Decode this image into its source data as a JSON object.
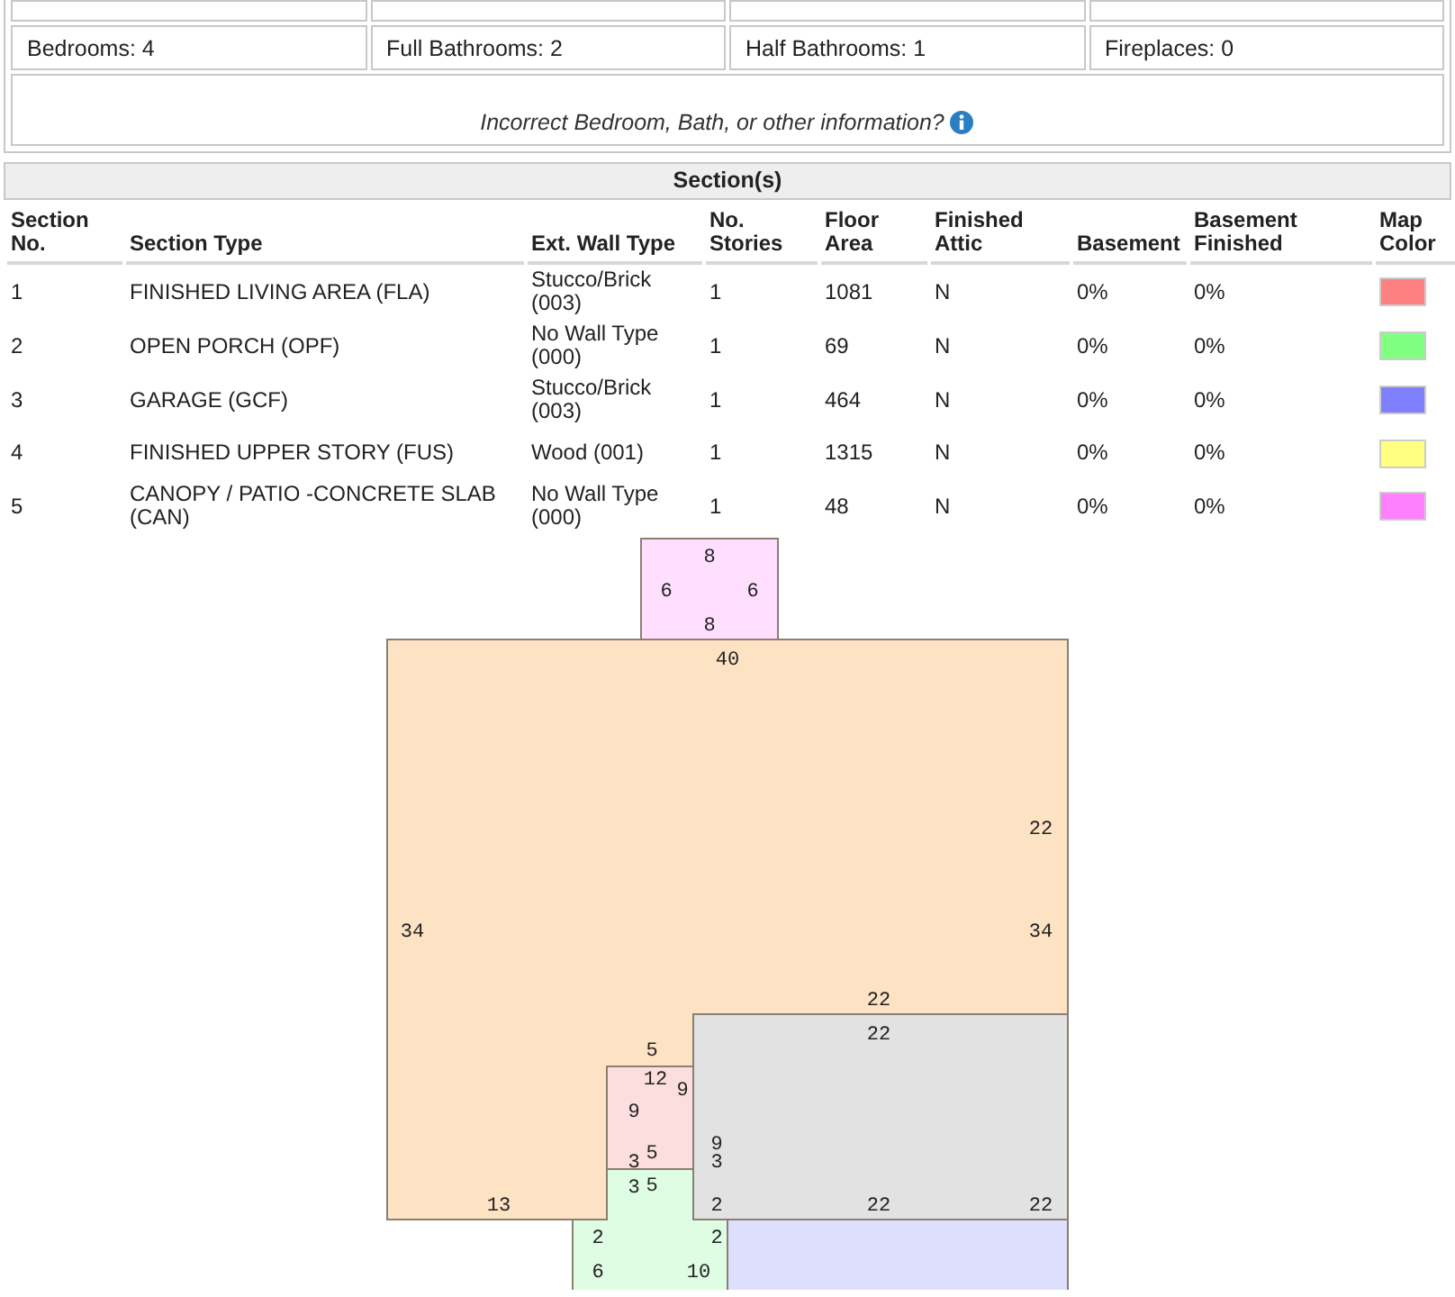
{
  "property_details": {
    "rows": [
      [
        "Bedrooms: 4",
        "Full Bathrooms: 2",
        "Half Bathrooms: 1",
        "Fireplaces: 0"
      ]
    ]
  },
  "info_link": {
    "text": "Incorrect Bedroom, Bath, or other information?"
  },
  "sections": {
    "title": "Section(s)",
    "columns": [
      "Section No.",
      "Section Type",
      "Ext. Wall Type",
      "No. Stories",
      "Floor Area",
      "Finished Attic",
      "Basement",
      "Basement Finished",
      "Map Color"
    ],
    "rows": [
      {
        "cells": [
          "1",
          "FINISHED LIVING AREA (FLA)",
          "Stucco/Brick (003)",
          "1",
          "1081",
          "N",
          "0%",
          "0%"
        ],
        "color": "#ff8080"
      },
      {
        "cells": [
          "2",
          "OPEN PORCH (OPF)",
          "No Wall Type (000)",
          "1",
          "69",
          "N",
          "0%",
          "0%"
        ],
        "color": "#80ff80"
      },
      {
        "cells": [
          "3",
          "GARAGE (GCF)",
          "Stucco/Brick (003)",
          "1",
          "464",
          "N",
          "0%",
          "0%"
        ],
        "color": "#8080ff"
      },
      {
        "cells": [
          "4",
          "FINISHED UPPER STORY (FUS)",
          "Wood (001)",
          "1",
          "1315",
          "N",
          "0%",
          "0%"
        ],
        "color": "#ffff80"
      },
      {
        "cells": [
          "5",
          "CANOPY / PATIO -CONCRETE SLAB (CAN)",
          "No Wall Type (000)",
          "1",
          "48",
          "N",
          "0%",
          "0%"
        ],
        "color": "#ff80ff"
      }
    ]
  },
  "sketch": {
    "labels": [
      "8",
      "6",
      "6",
      "8",
      "40",
      "22",
      "34",
      "34",
      "22",
      "5",
      "13",
      "12",
      "9",
      "9",
      "3",
      "5",
      "22",
      "9",
      "3",
      "2",
      "22",
      "22",
      "3",
      "5",
      "2",
      "2",
      "6",
      "10"
    ]
  }
}
